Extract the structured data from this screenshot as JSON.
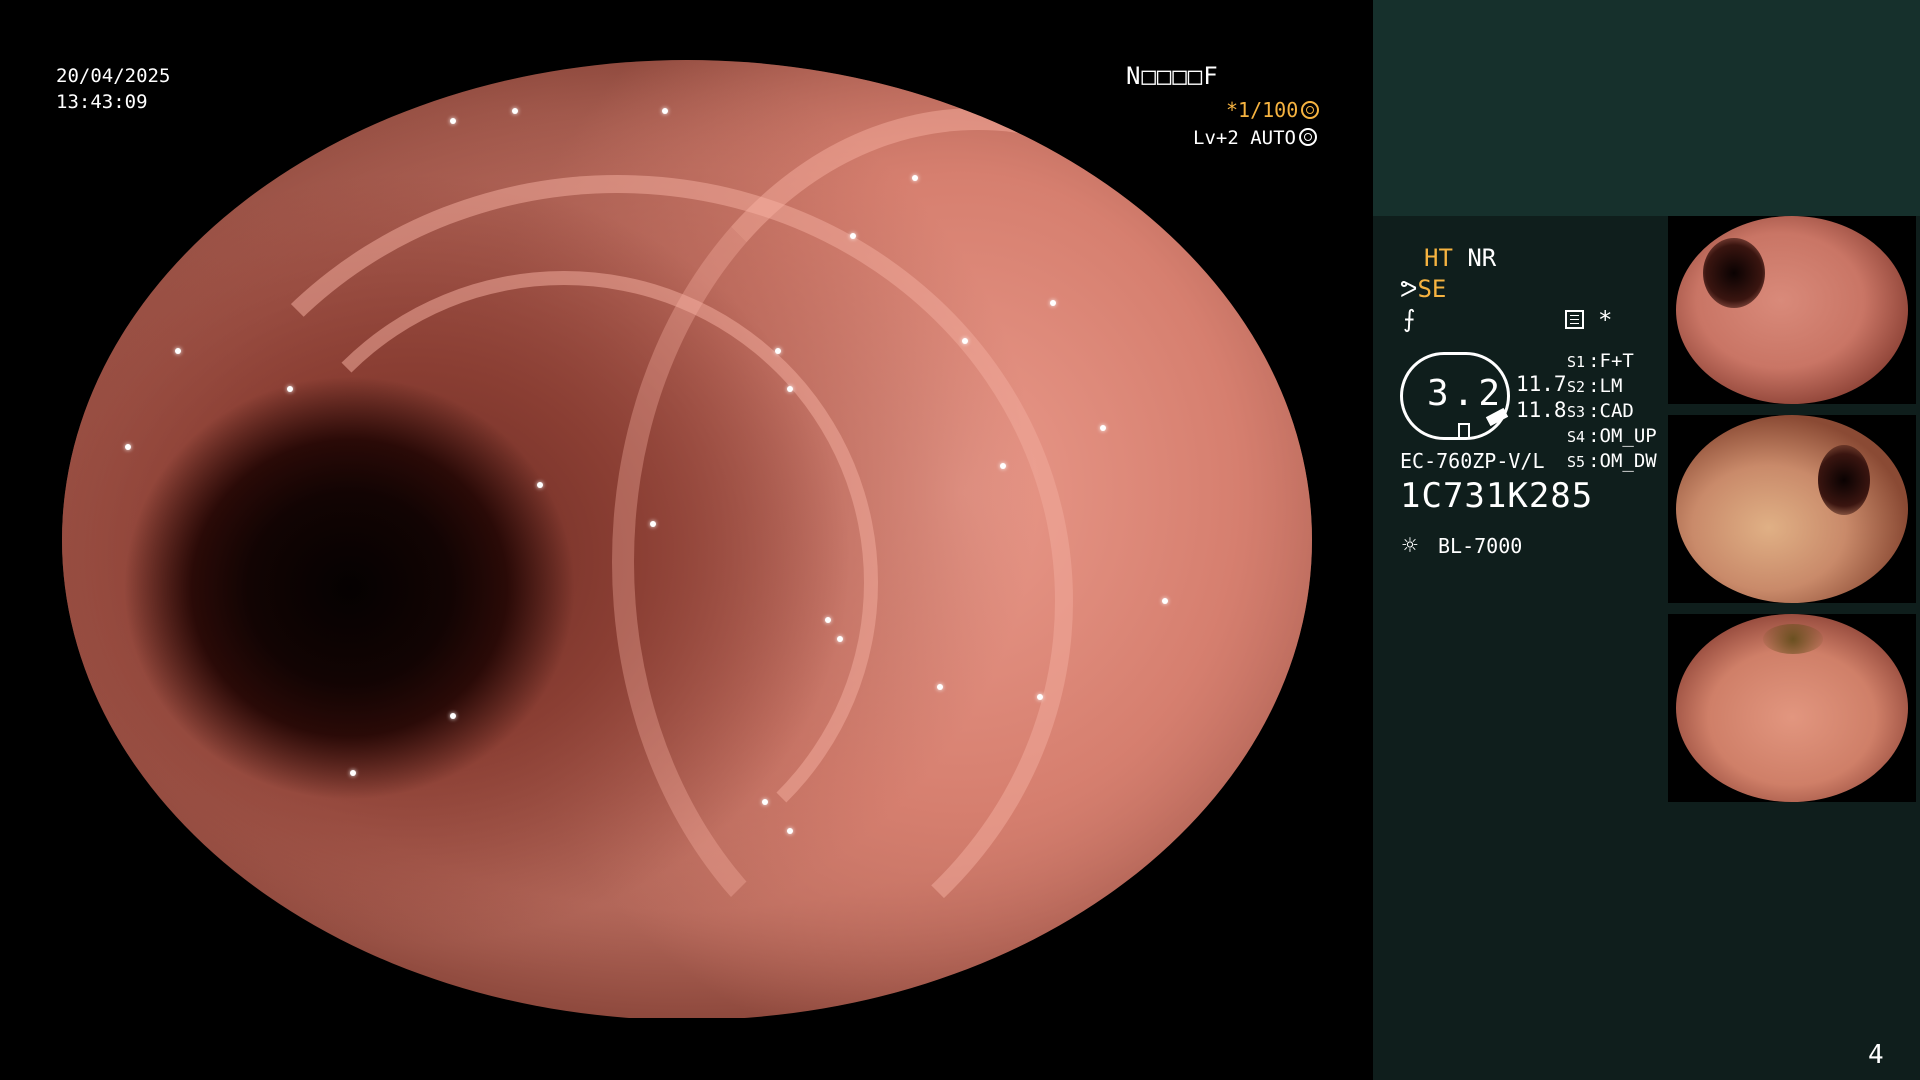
{
  "osd": {
    "date": "20/04/2025",
    "time": "13:43:09",
    "status_code": "N□□□□F",
    "shutter": "*1/100",
    "shutter_icon": "aperture-icon",
    "level": "Lv+2",
    "mode": "AUTO",
    "mode_icon": "auto-iris-icon"
  },
  "panel": {
    "enhance_ht": "HT",
    "enhance_nr": "NR",
    "structure_se": "SE",
    "zoom_value": "3.2",
    "value_1": "11.7",
    "value_2": "11.8",
    "switches": [
      {
        "key": "S1",
        "value": "F+T"
      },
      {
        "key": "S2",
        "value": "LM"
      },
      {
        "key": "S3",
        "value": "CAD"
      },
      {
        "key": "S4",
        "value": "OM_UP"
      },
      {
        "key": "S5",
        "value": "OM_DW"
      }
    ],
    "scope_model": "EC-760ZP-V/L",
    "serial": "1C731K285",
    "light_source": "BL-7000",
    "star": "*"
  },
  "thumbnails": [
    {
      "name": "captured-image-1"
    },
    {
      "name": "captured-image-2"
    },
    {
      "name": "captured-image-3"
    }
  ],
  "page_number": "4",
  "colors": {
    "accent_amber": "#f6b340",
    "panel_bg": "#0f1e1c",
    "panel_header": "#16302c"
  }
}
